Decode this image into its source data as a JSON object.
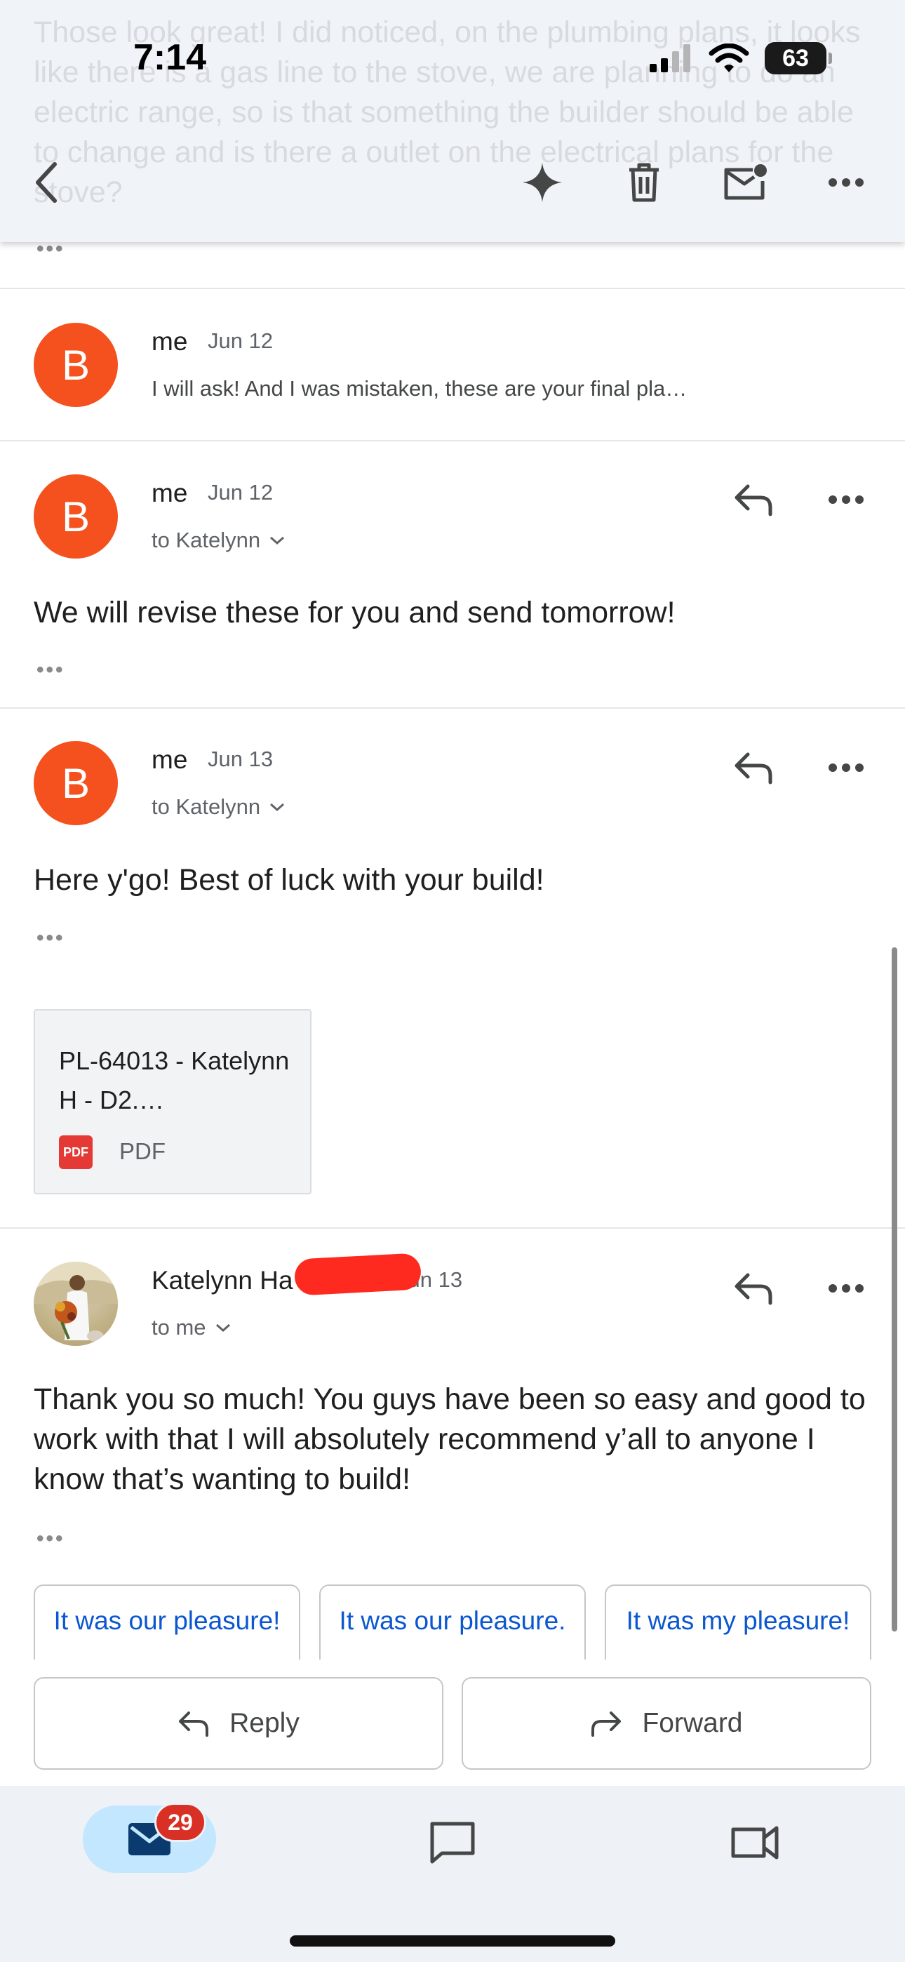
{
  "status_bar": {
    "time": "7:14",
    "battery": "63"
  },
  "header": {
    "background_text": "Those look great! I did noticed, on the plumbing plans, it looks like there is a gas line to the stove, we are planning to do an electric range, so is that something the builder should be able to change and is there a outlet on the electrical plans for the stove?",
    "icons": [
      "back-arrow-icon",
      "sparkle-icon",
      "trash-icon",
      "mark-unread-icon",
      "more-icon"
    ]
  },
  "messages": [
    {
      "avatar_letter": "B",
      "sender": "me",
      "date": "Jun 12",
      "snippet": "I will ask! And I was mistaken, these are your final pla…"
    },
    {
      "avatar_letter": "B",
      "sender": "me",
      "date": "Jun 12",
      "to": "to Katelynn",
      "body": "We will revise these for you and send tomorrow!"
    },
    {
      "avatar_letter": "B",
      "sender": "me",
      "date": "Jun 13",
      "to": "to Katelynn",
      "body": "Here y'go! Best of luck with your build!",
      "attachment": {
        "name": "PL-64013 - Katelynn H - D2.…",
        "type": "PDF",
        "icon_label": "PDF"
      }
    },
    {
      "sender": "Katelynn Ha",
      "date": "Jun 13",
      "to": "to me",
      "body": "Thank you so much! You guys have been so easy and good to work with that I will absolutely recommend y’all to anyone I know that’s wanting to build!"
    }
  ],
  "smart_replies": [
    "It was our pleasure!",
    "It was our pleasure.",
    "It was my pleasure!"
  ],
  "actions": {
    "reply": "Reply",
    "forward": "Forward"
  },
  "bottom_nav": {
    "mail_badge": "29"
  },
  "colors": {
    "avatar": "#f4511e",
    "link": "#0b57d0",
    "badge": "#d93025",
    "active_nav": "#c2e7ff"
  }
}
